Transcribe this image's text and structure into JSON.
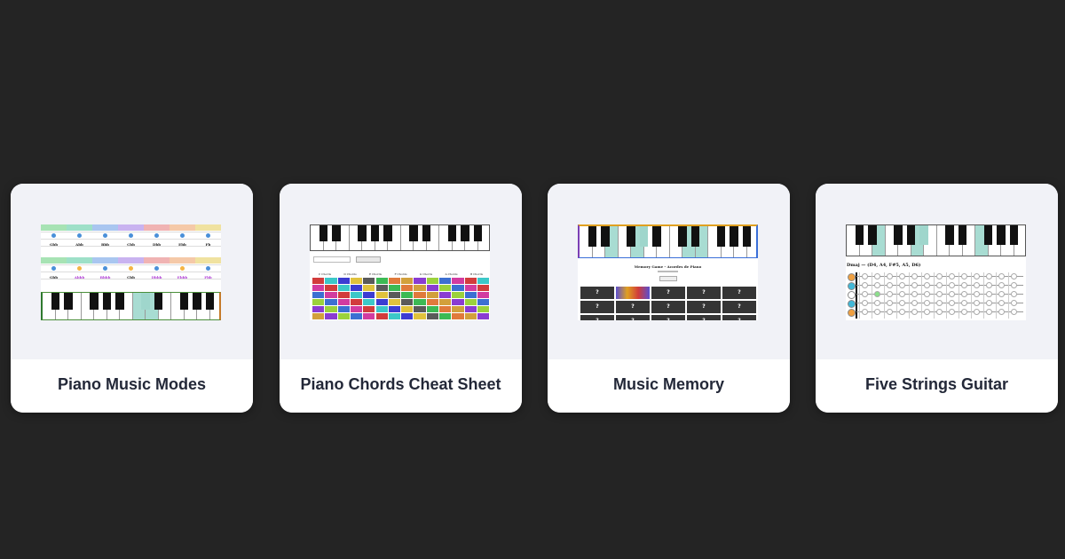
{
  "cards": [
    {
      "title": "Piano Music Modes",
      "thumbnail": {
        "scale_title_1": "Escala mayor de Gbb",
        "scale_title_2": "Escala mayor de Gbb (modo locrian)",
        "notes_row_1": [
          "Gbb",
          "Abb",
          "Bbb",
          "Cbb",
          "Dbb",
          "Ebb",
          "Fb"
        ],
        "notes_row_2": [
          "Gbb",
          "Abbb",
          "Bbbb",
          "Cbb",
          "Dbbb",
          "Ebbb",
          "Fbb"
        ]
      }
    },
    {
      "title": "Piano Chords Cheat Sheet",
      "thumbnail": {
        "chord_columns": [
          "C Chords",
          "D Chords",
          "E Chords",
          "F Chords",
          "G Chords",
          "A Chords",
          "B Chords"
        ]
      }
    },
    {
      "title": "Music Memory",
      "thumbnail": {
        "game_title": "Memory Game - Acordes de Piano",
        "tile_symbol": "?"
      }
    },
    {
      "title": "Five Strings Guitar",
      "thumbnail": {
        "chord_label": "Dmaj — (D4, A4, F#5, A5, D6)"
      }
    }
  ],
  "colors": {
    "background": "#242424",
    "card": "#f4f5f9",
    "card_label": "#232838"
  }
}
